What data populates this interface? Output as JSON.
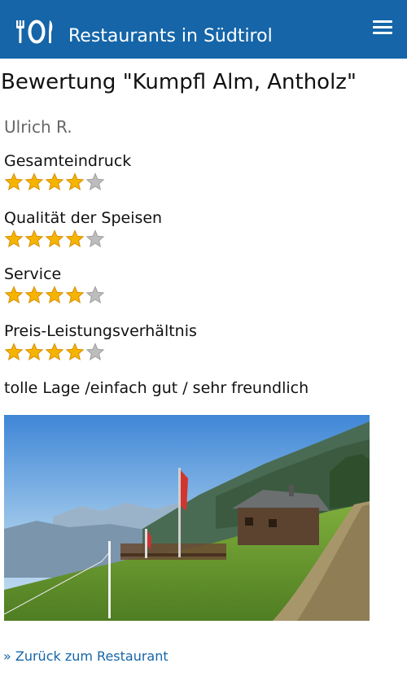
{
  "header": {
    "app_title": "Restaurants in Südtirol",
    "logo_icon": "cutlery-plate-icon",
    "menu_icon": "hamburger-menu-icon"
  },
  "review": {
    "title": "Bewertung \"Kumpfl Alm, Antholz\"",
    "author": "Ulrich R.",
    "criteria": [
      {
        "label": "Gesamteindruck",
        "rating": 4,
        "max": 5
      },
      {
        "label": "Qualität der Speisen",
        "rating": 4,
        "max": 5
      },
      {
        "label": "Service",
        "rating": 4,
        "max": 5
      },
      {
        "label": "Preis-Leistungsverhältnis",
        "rating": 4,
        "max": 5
      }
    ],
    "comment": "tolle Lage /einfach gut / sehr freundlich"
  },
  "footer": {
    "back_link": "» Zurück zum Restaurant"
  },
  "colors": {
    "header_bg": "#1565a8",
    "star_filled": "#f5b400",
    "star_empty": "#bdbdbd",
    "link": "#1565a8"
  }
}
